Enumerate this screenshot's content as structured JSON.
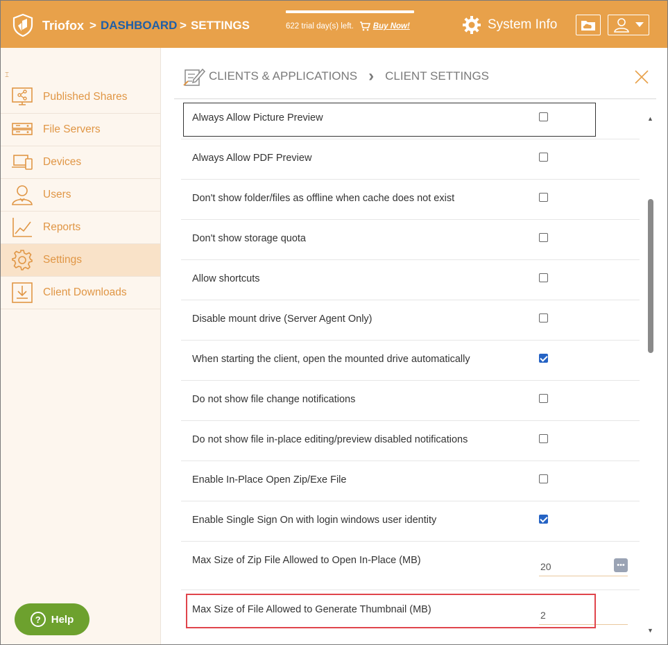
{
  "header": {
    "brand": "Triofox",
    "breadcrumb": [
      {
        "sep": ">",
        "label": "DASHBOARD"
      },
      {
        "sep": ">",
        "label": "SETTINGS"
      }
    ],
    "trial_text": "622 trial day(s) left.",
    "buy_label": "Buy Now!",
    "system_info_label": "System Info",
    "colors": {
      "bar": "#e8a14a",
      "dashboard_link": "#1f5fa8"
    }
  },
  "sidebar": {
    "collapse_glyph": "⌶",
    "items": [
      {
        "label": "Published Shares",
        "icon": "share-monitor-icon"
      },
      {
        "label": "File Servers",
        "icon": "server-icon"
      },
      {
        "label": "Devices",
        "icon": "devices-icon"
      },
      {
        "label": "Users",
        "icon": "user-icon"
      },
      {
        "label": "Reports",
        "icon": "chart-icon"
      },
      {
        "label": "Settings",
        "icon": "gear-icon",
        "active": true
      },
      {
        "label": "Client Downloads",
        "icon": "download-icon"
      }
    ],
    "help_label": "Help"
  },
  "content": {
    "title_section": "CLIENTS & APPLICATIONS",
    "title_page": "CLIENT SETTINGS",
    "chevron": "›",
    "rows": [
      {
        "label": "Always Allow Picture Preview",
        "checked": false
      },
      {
        "label": "Always Allow PDF Preview",
        "checked": false
      },
      {
        "label": "Don't show folder/files as offline when cache does not exist",
        "checked": false
      },
      {
        "label": "Don't show storage quota",
        "checked": false
      },
      {
        "label": "Allow shortcuts",
        "checked": false
      },
      {
        "label": "Disable mount drive (Server Agent Only)",
        "checked": false
      },
      {
        "label": "When starting the client, open the mounted drive automatically",
        "checked": true
      },
      {
        "label": "Do not show file change notifications",
        "checked": false
      },
      {
        "label": "Do not show file in-place editing/preview disabled notifications",
        "checked": false
      },
      {
        "label": "Enable In-Place Open Zip/Exe File",
        "checked": false
      },
      {
        "label": "Enable Single Sign On with login windows user identity",
        "checked": true
      }
    ],
    "zip_size": {
      "label": "Max Size of Zip File Allowed to Open In-Place (MB)",
      "value": "20",
      "dots": "•••"
    },
    "thumb_size": {
      "label": "Max Size of File Allowed to Generate Thumbnail (MB)",
      "value": "2"
    }
  }
}
